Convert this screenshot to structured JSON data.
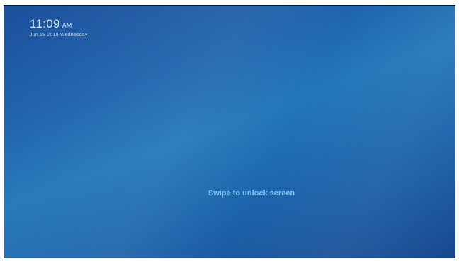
{
  "lock_screen": {
    "time": "11:09",
    "ampm": "AM",
    "date": "Jun.19 2019 Wednesday",
    "unlock_hint": "Swipe to unlock screen"
  }
}
